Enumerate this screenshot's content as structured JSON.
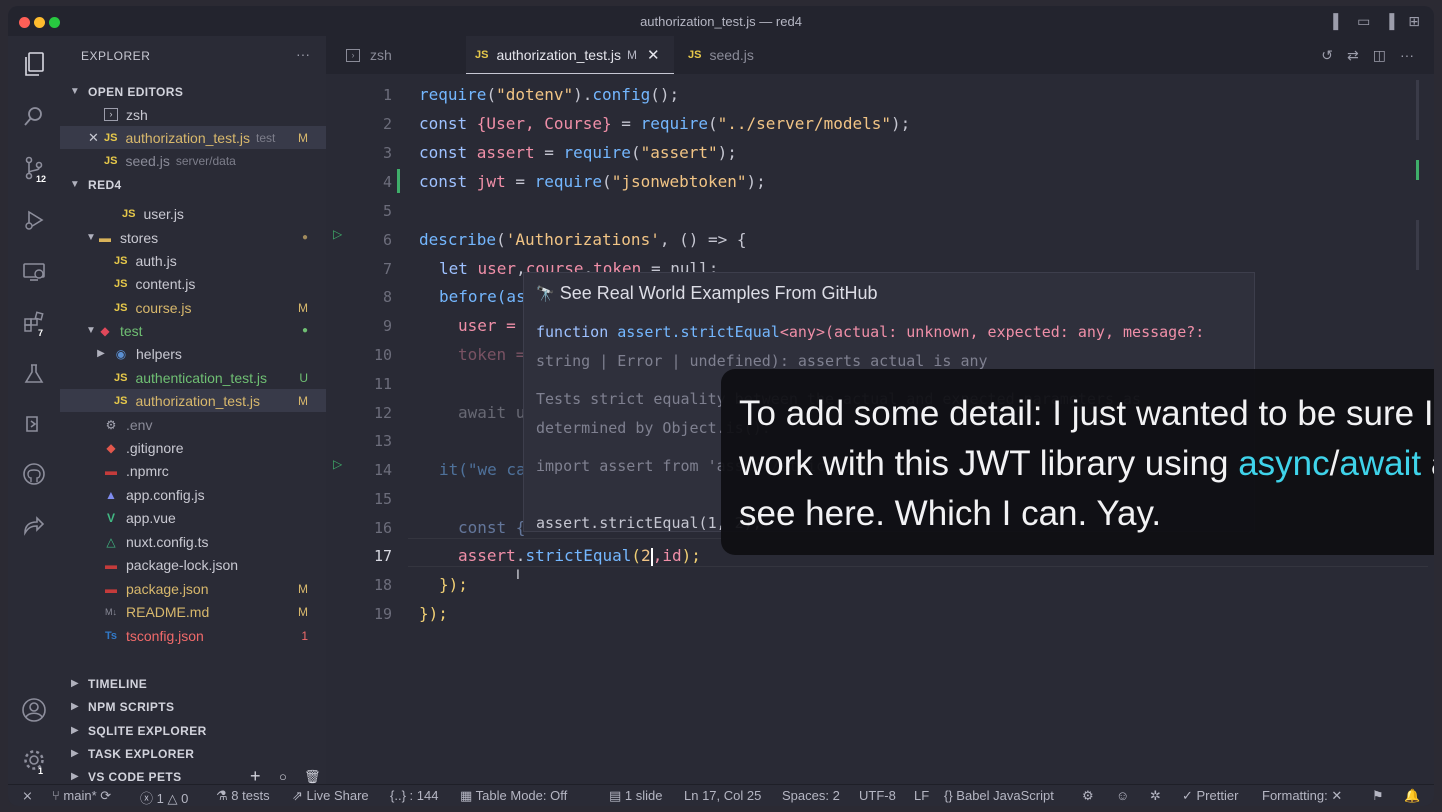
{
  "window": {
    "title": "authorization_test.js — red4"
  },
  "activity_bar": {
    "scm_badge": "12",
    "extensions_badge": "7",
    "settings_badge": "1"
  },
  "sidebar": {
    "header": "EXPLORER",
    "more": "···",
    "open_editors": {
      "title": "OPEN EDITORS",
      "items": [
        {
          "name": "zsh"
        },
        {
          "name": "authorization_test.js",
          "desc": "test",
          "status": "M"
        },
        {
          "name": "seed.js",
          "desc": "server/data"
        }
      ]
    },
    "workspace": {
      "title": "RED4",
      "items": [
        {
          "name": "user.js"
        },
        {
          "name": "stores"
        },
        {
          "name": "auth.js"
        },
        {
          "name": "content.js"
        },
        {
          "name": "course.js",
          "status": "M"
        },
        {
          "name": "test"
        },
        {
          "name": "helpers"
        },
        {
          "name": "authentication_test.js",
          "status": "U"
        },
        {
          "name": "authorization_test.js",
          "status": "M"
        },
        {
          "name": ".env"
        },
        {
          "name": ".gitignore"
        },
        {
          "name": ".npmrc"
        },
        {
          "name": "app.config.js"
        },
        {
          "name": "app.vue"
        },
        {
          "name": "nuxt.config.ts"
        },
        {
          "name": "package-lock.json"
        },
        {
          "name": "package.json",
          "status": "M"
        },
        {
          "name": "README.md",
          "status": "M"
        },
        {
          "name": "tsconfig.json",
          "status": "1"
        }
      ]
    },
    "panels": [
      "TIMELINE",
      "NPM SCRIPTS",
      "SQLITE EXPLORER",
      "TASK EXPLORER",
      "VS CODE PETS"
    ]
  },
  "tabs": [
    {
      "label": "zsh"
    },
    {
      "label": "authorization_test.js",
      "status": "M"
    },
    {
      "label": "seed.js"
    }
  ],
  "code": {
    "line_numbers": [
      "1",
      "2",
      "3",
      "4",
      "5",
      "6",
      "7",
      "8",
      "9",
      "10",
      "11",
      "12",
      "13",
      "14",
      "15",
      "16",
      "17",
      "18",
      "19"
    ],
    "l1": {
      "a": "require",
      "b": "(",
      "c": "\"dotenv\"",
      "d": ").",
      "e": "config",
      "f": "();"
    },
    "l2": {
      "a": "const ",
      "b": "{User, Course}",
      "c": " = ",
      "d": "require",
      "e": "(",
      "f": "\"../server/models\"",
      "g": ");"
    },
    "l3": {
      "a": "const ",
      "b": "assert",
      "c": " = ",
      "d": "require",
      "e": "(",
      "f": "\"assert\"",
      "g": ");"
    },
    "l4": {
      "a": "const ",
      "b": "jwt",
      "c": " = ",
      "d": "require",
      "e": "(",
      "f": "\"jsonwebtoken\"",
      "g": ");"
    },
    "l6": {
      "a": "describe",
      "b": "(",
      "c": "'Authorizations'",
      "d": ", () => {"
    },
    "l7": {
      "a": "let ",
      "b": "user",
      "c": ",",
      "d": "course",
      "e": ",",
      "f": "token",
      "g": " = null;"
    },
    "l8": "before(as",
    "l9": "user =",
    "l10": "token =",
    "l12": "await u",
    "l14": "it(\"we ca",
    "l16": "const {",
    "l17": {
      "a": "assert",
      "b": ".",
      "c": "strictEqual",
      "d": "(",
      "e": "2",
      "f": ",id",
      "g": ");"
    },
    "l18": "});",
    "l19": "});"
  },
  "hover": {
    "title": "See Real World Examples From GitHub",
    "sig_fn": "function ",
    "sig_name": "assert.strictEqual",
    "sig_rest": "<any>(actual: unknown, expected: any, message?:",
    "sig_line2": "string | Error | undefined): asserts actual is any",
    "doc_line1": "Tests strict equality between the actual and expected parameters as",
    "doc_line2": "determined by Object.is().",
    "example1": "import assert from 'assert/strict';",
    "example2": "assert.strictEqual(1, 2);"
  },
  "caption": {
    "pre": "To add some detail: I just wanted to be sure I could work with this JWT library using ",
    "hl1": "async",
    "slash": "/",
    "hl2": "await",
    "post": " as you see here. Which I can. Yay."
  },
  "status_bar": {
    "branch": "main*",
    "errors": "1",
    "warnings": "0",
    "tests": "8 tests",
    "live_share": "Live Share",
    "json_count": "{..} : 144",
    "table_mode": "Table Mode: Off",
    "slides": "1 slide",
    "cursor": "Ln 17, Col 25",
    "spaces": "Spaces: 2",
    "encoding": "UTF-8",
    "eol": "LF",
    "language": "Babel JavaScript",
    "prettier": "Prettier",
    "formatting": "Formatting: ✕"
  },
  "colors": {
    "accent": "#3fd3ea",
    "modified": "#d8b86c",
    "untracked": "#6fbf73",
    "error": "#f06a6a"
  }
}
